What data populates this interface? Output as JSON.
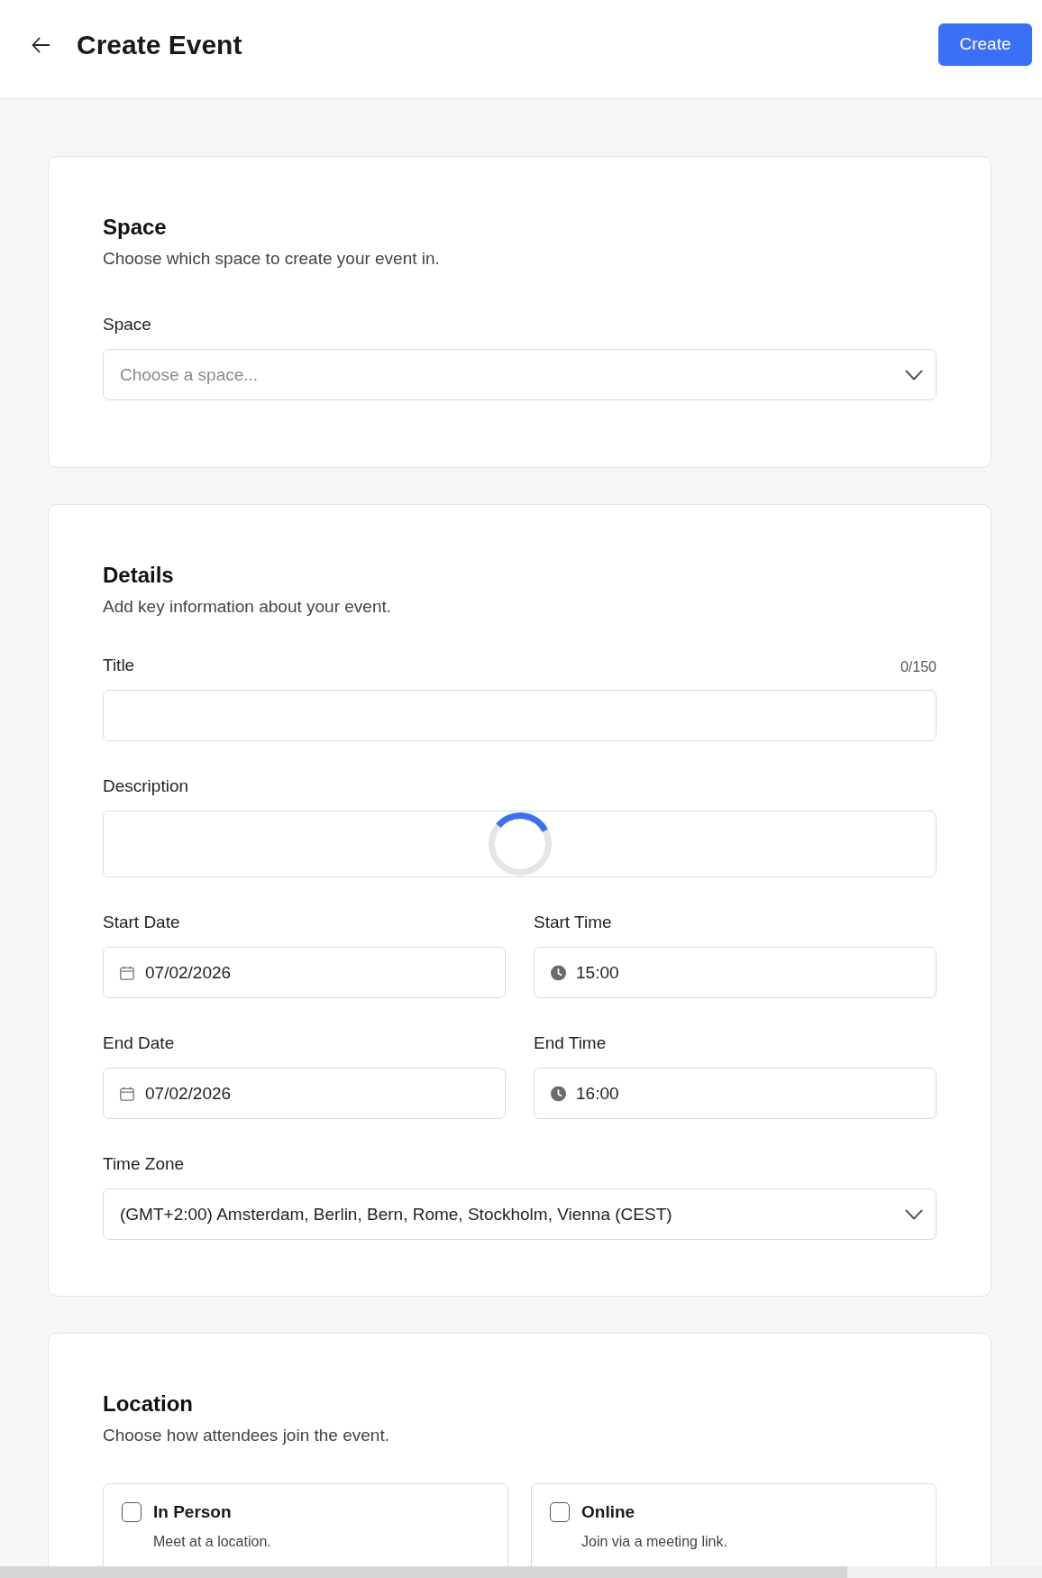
{
  "header": {
    "title": "Create Event",
    "button": "Create"
  },
  "sections": [
    {
      "heading": "Space",
      "description": "Choose which space to create your event in.",
      "fields": [
        {
          "kind": "select",
          "label": "Space",
          "placeholder": "Choose a space..."
        }
      ]
    },
    {
      "heading": "Details",
      "description": "Add key information about your event.",
      "fields": [
        {
          "kind": "text",
          "label": "Title",
          "counter": "0/150"
        },
        {
          "kind": "editor",
          "label": "Description",
          "loading": true
        },
        {
          "kind": "date",
          "label": "Start Date",
          "value": "07/02/2026"
        },
        {
          "kind": "time",
          "label": "Start Time",
          "value": "15:00"
        },
        {
          "kind": "date",
          "label": "End Date",
          "value": "07/02/2026"
        },
        {
          "kind": "time",
          "label": "End Time",
          "value": "16:00"
        },
        {
          "kind": "select",
          "label": "Time Zone",
          "value": "(GMT+2:00) Amsterdam, Berlin, Bern, Rome, Stockholm, Vienna (CEST)"
        }
      ]
    },
    {
      "heading": "Location",
      "description": "Choose how attendees join the event.",
      "options": [
        {
          "title": "In Person",
          "description": "Meet at a location.",
          "checked": false
        },
        {
          "title": "Online",
          "description": "Join via a meeting link.",
          "checked": false
        }
      ]
    }
  ]
}
